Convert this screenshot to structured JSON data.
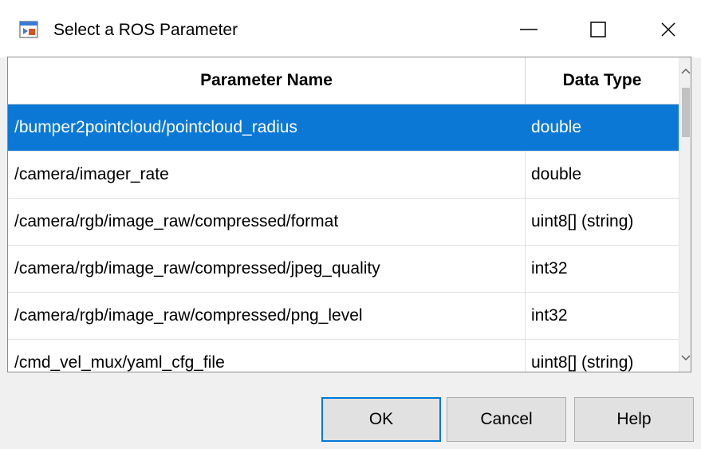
{
  "window": {
    "title": "Select a ROS Parameter",
    "icon": "matlab-app-icon"
  },
  "table": {
    "columns": [
      "Parameter Name",
      "Data Type"
    ],
    "rows": [
      {
        "name": "/bumper2pointcloud/pointcloud_radius",
        "type": "double",
        "selected": true
      },
      {
        "name": "/camera/imager_rate",
        "type": "double",
        "selected": false
      },
      {
        "name": "/camera/rgb/image_raw/compressed/format",
        "type": "uint8[] (string)",
        "selected": false
      },
      {
        "name": "/camera/rgb/image_raw/compressed/jpeg_quality",
        "type": "int32",
        "selected": false
      },
      {
        "name": "/camera/rgb/image_raw/compressed/png_level",
        "type": "int32",
        "selected": false
      },
      {
        "name": "/cmd_vel_mux/yaml_cfg_file",
        "type": "uint8[] (string)",
        "selected": false
      }
    ]
  },
  "buttons": {
    "ok": "OK",
    "cancel": "Cancel",
    "help": "Help"
  },
  "colors": {
    "selection": "#0b78d6",
    "focus_border": "#0078d7"
  }
}
